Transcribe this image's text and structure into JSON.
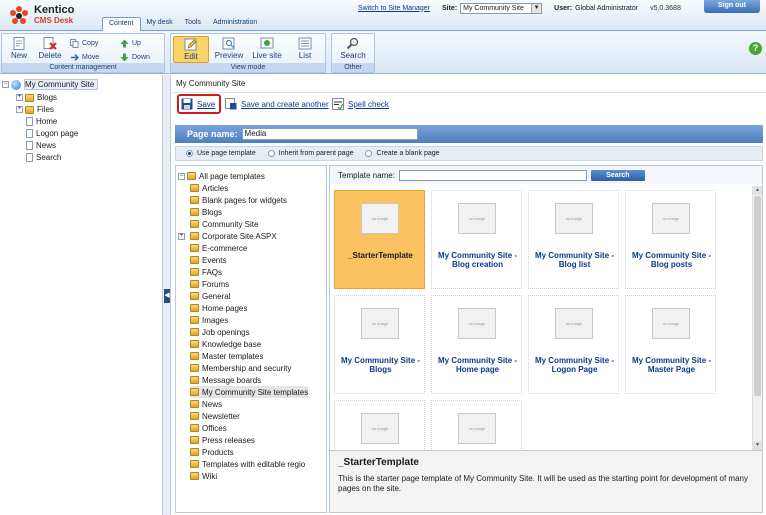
{
  "header": {
    "brand": "Kentico",
    "product": "CMS Desk",
    "modules": [
      "Content",
      "My desk",
      "Tools",
      "Administration"
    ],
    "switch_link": "Switch to Site Manager",
    "site_label": "Site:",
    "site_value": "My Community Site",
    "user_label": "User:",
    "user_value": "Global Administrator",
    "version": "v5.0.3688",
    "signout": "Sign out"
  },
  "toolbar": {
    "content_group": "Content management",
    "new": "New",
    "delete": "Delete",
    "copy": "Copy",
    "move": "Move",
    "up": "Up",
    "down": "Down",
    "view_group": "View mode",
    "edit": "Edit",
    "preview": "Preview",
    "livesite": "Live site",
    "list": "List",
    "other_group": "Other",
    "search": "Search",
    "help": "?"
  },
  "tree": {
    "root": "My Community Site",
    "items": [
      "Blogs",
      "Files",
      "Home",
      "Logon page",
      "News",
      "Search"
    ]
  },
  "right": {
    "breadcrumb": "My Community Site",
    "save": "Save",
    "save_create": "Save and create another",
    "spell": "Spell check",
    "page_name_label": "Page name:",
    "page_name_value": "Media",
    "mode_template": "Use page template",
    "mode_inherit": "Inherit from parent page",
    "mode_blank": "Create a blank page"
  },
  "categories": {
    "root": "All page templates",
    "items": [
      "Articles",
      "Blank pages for widgets",
      "Blogs",
      "Community Site",
      "Corporate Site ASPX",
      "E-commerce",
      "Events",
      "FAQs",
      "Forums",
      "General",
      "Home pages",
      "Images",
      "Job openings",
      "Knowledge base",
      "Master templates",
      "Membership and security",
      "Message boards",
      "My Community Site templates",
      "News",
      "Newsletter",
      "Offices",
      "Press releases",
      "Products",
      "Templates with editable regio",
      "Wiki"
    ],
    "selected": "My Community Site templates"
  },
  "templates": {
    "search_label": "Template name:",
    "search_value": "",
    "search_button": "Search",
    "no_image": "no image",
    "tiles": [
      {
        "name": "_StarterTemplate"
      },
      {
        "name": "My Community Site - Blog creation"
      },
      {
        "name": "My Community Site - Blog list"
      },
      {
        "name": "My Community Site - Blog posts"
      },
      {
        "name": "My Community Site - Blogs"
      },
      {
        "name": "My Community Site - Home page"
      },
      {
        "name": "My Community Site - Logon Page"
      },
      {
        "name": "My Community Site - Master Page"
      },
      {
        "name": ""
      },
      {
        "name": ""
      }
    ],
    "desc_title": "_StarterTemplate",
    "desc_text": "This is the starter page template of My Community Site. It will be used as the starting point for development of many pages on the site."
  },
  "colors": {
    "accent": "#4d7ec1",
    "selected_tile": "#fbc262",
    "save_highlight": "#cc1c1c"
  }
}
